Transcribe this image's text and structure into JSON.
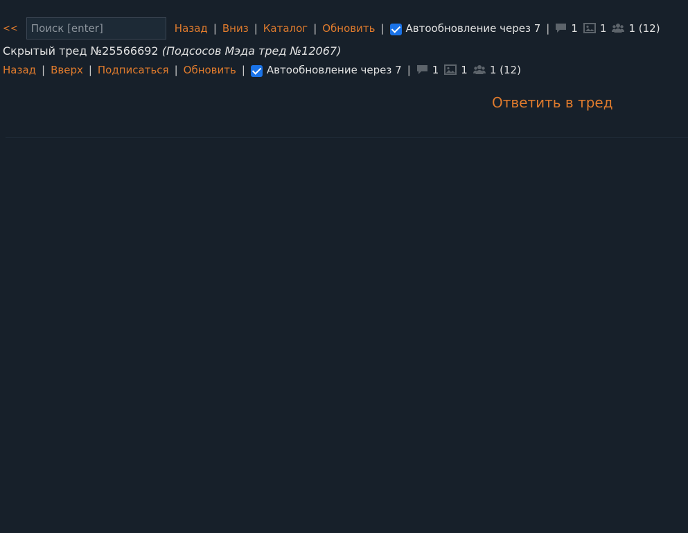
{
  "top_nav": {
    "back_arrows": "<<",
    "search_placeholder": "Поиск [enter]",
    "links": [
      "Назад",
      "Вниз",
      "Каталог",
      "Обновить"
    ],
    "autoupdate_label": "Автообновление через 7",
    "posts_count": "1",
    "images_count": "1",
    "posters_count": "1 (12)"
  },
  "thread": {
    "hidden_label": "Скрытый тред №25566692",
    "subject": "(Подсосов Мэда тред №12067)"
  },
  "bottom_nav": {
    "links": [
      "Назад",
      "Вверх",
      "Подписаться",
      "Обновить"
    ],
    "autoupdate_label": "Автообновление через 7",
    "posts_count": "1",
    "images_count": "1",
    "posters_count": "1 (12)"
  },
  "reply_link": "Ответить в тред",
  "colors": {
    "background": "#17202a",
    "link": "#e07b2d",
    "text": "#e1e1e1",
    "checkbox": "#1a73e8",
    "icon": "#5d646b"
  },
  "icons": [
    "comment-icon",
    "image-icon",
    "users-icon"
  ]
}
